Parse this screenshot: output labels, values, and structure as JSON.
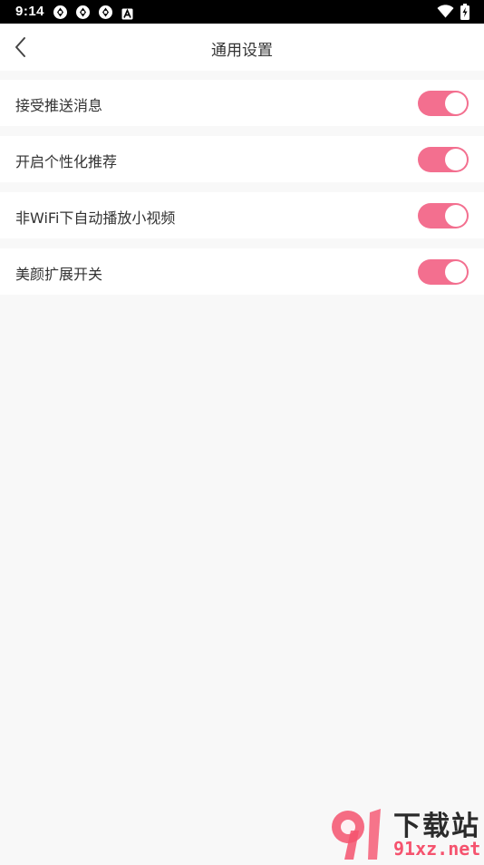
{
  "status_bar": {
    "time": "9:14",
    "notification_icons": [
      "sync-icon",
      "sync-icon",
      "sync-icon",
      "a-icon"
    ],
    "status_icons": [
      "wifi-icon",
      "battery-charging-icon"
    ]
  },
  "header": {
    "title": "通用设置",
    "back_icon": "chevron-left-icon"
  },
  "settings": [
    {
      "label": "接受推送消息",
      "enabled": true
    },
    {
      "label": "开启个性化推荐",
      "enabled": true
    },
    {
      "label": "非WiFi下自动播放小视频",
      "enabled": true
    },
    {
      "label": "美颜扩展开关",
      "enabled": true
    }
  ],
  "watermark": {
    "title": "下载站",
    "url": "91xz.net"
  },
  "colors": {
    "accent": "#f36f8f",
    "background": "#f8f8f8",
    "text": "#333333",
    "watermark_red": "#f5536e"
  }
}
